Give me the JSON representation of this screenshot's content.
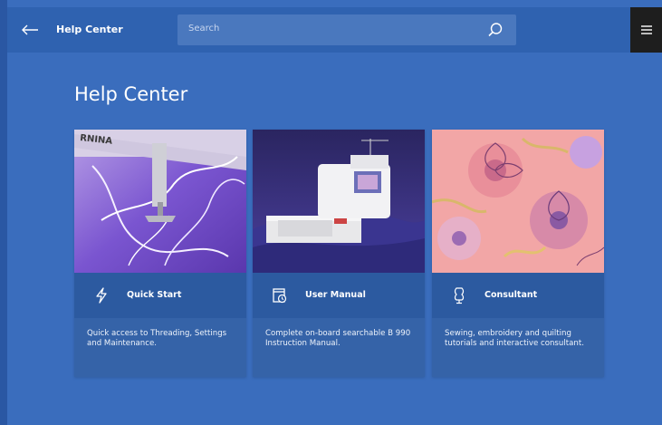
{
  "colors": {
    "background": "#3a6dbd",
    "topbar": "#2f62b0",
    "card": "#3563a8",
    "card_header": "#2c5aa0",
    "menu_button": "#1e1e1e"
  },
  "topbar": {
    "back_icon": "arrow-left-icon",
    "title": "Help Center",
    "search": {
      "placeholder": "Search",
      "icon": "search-icon"
    },
    "menu_icon": "hamburger-menu-icon"
  },
  "main": {
    "title": "Help Center",
    "cards": [
      {
        "title": "Quick Start",
        "icon": "lightning-icon",
        "description": "Quick access to Threading, Settings and Maintenance.",
        "image": "embroidery-closeup-image"
      },
      {
        "title": "User Manual",
        "icon": "manual-clock-icon",
        "description": "Complete on-board searchable B 990 Instruction Manual.",
        "image": "sewing-machine-image"
      },
      {
        "title": "Consultant",
        "icon": "dress-form-icon",
        "description": "Sewing, embroidery and quilting tutorials and interactive consultant.",
        "image": "floral-embroidery-image"
      }
    ]
  }
}
